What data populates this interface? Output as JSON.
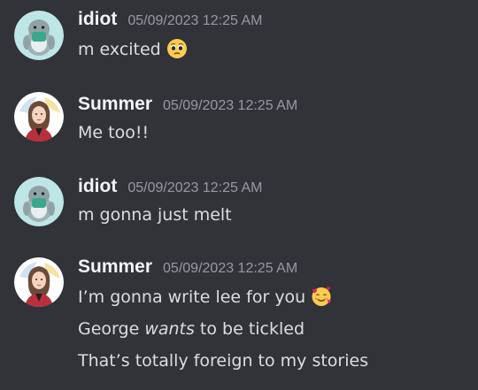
{
  "messages": [
    {
      "username": "idiot",
      "timestamp": "05/09/2023 12:25 AM",
      "avatar_icon": "penguin-avatar-icon",
      "lines": [
        {
          "text": "m excited",
          "emoji": "pleading-face-icon"
        }
      ]
    },
    {
      "username": "Summer",
      "timestamp": "05/09/2023 12:25 AM",
      "avatar_icon": "girl-portrait-avatar-icon",
      "lines": [
        {
          "text": "Me too!!"
        }
      ]
    },
    {
      "username": "idiot",
      "timestamp": "05/09/2023 12:25 AM",
      "avatar_icon": "penguin-avatar-icon",
      "lines": [
        {
          "text": "m gonna just melt"
        }
      ]
    },
    {
      "username": "Summer",
      "timestamp": "05/09/2023 12:25 AM",
      "avatar_icon": "girl-portrait-avatar-icon",
      "lines": [
        {
          "text": "I’m gonna write lee for you",
          "emoji": "smiling-face-with-hearts-icon"
        },
        {
          "before": "George ",
          "italic": "wants",
          "after": " to be tickled"
        },
        {
          "text": "That’s totally foreign to my stories"
        }
      ]
    }
  ],
  "colors": {
    "background": "#313338",
    "username": "#f2f3f5",
    "timestamp": "#949ba4",
    "message_text": "#dbdee1"
  }
}
